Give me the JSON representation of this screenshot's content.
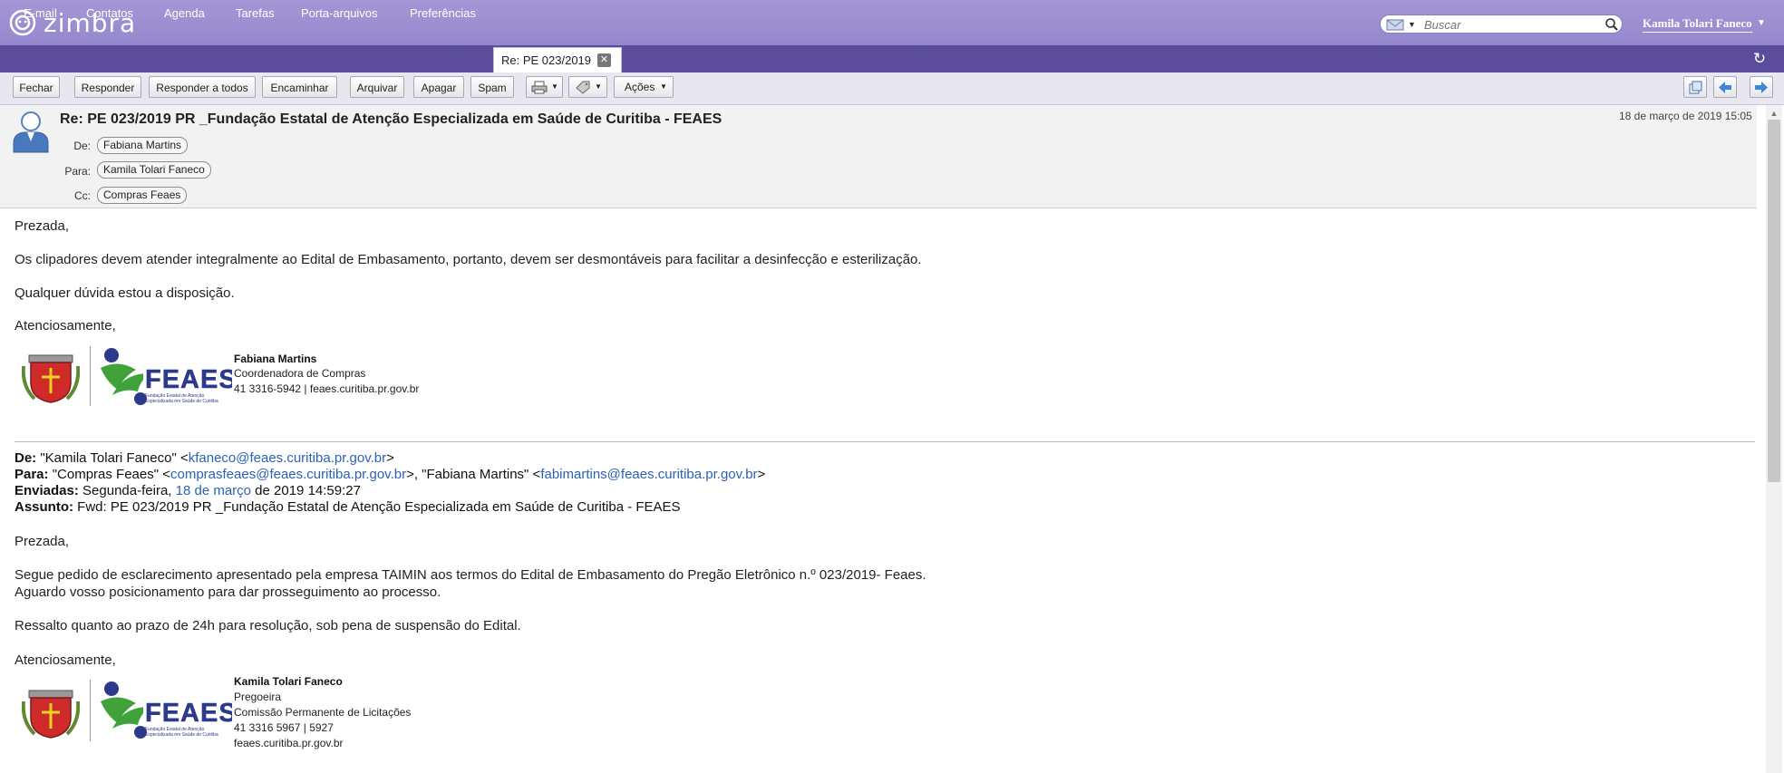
{
  "app": {
    "logo_text": "zimbra"
  },
  "search": {
    "placeholder": "Buscar"
  },
  "user": {
    "name": "Kamila Tolari Faneco"
  },
  "tabs": [
    {
      "label": "E-mail"
    },
    {
      "label": "Contatos"
    },
    {
      "label": "Agenda"
    },
    {
      "label": "Tarefas"
    },
    {
      "label": "Porta-arquivos"
    },
    {
      "label": "Preferências"
    }
  ],
  "active_tab": {
    "label": "Re: PE 023/2019"
  },
  "toolbar": {
    "close": "Fechar",
    "reply": "Responder",
    "reply_all": "Responder a todos",
    "forward": "Encaminhar",
    "archive": "Arquivar",
    "delete": "Apagar",
    "spam": "Spam",
    "actions": "Ações"
  },
  "message": {
    "subject": "Re: PE 023/2019 PR _Fundação Estatal de Atenção Especializada em Saúde de Curitiba - FEAES",
    "date": "18 de março de 2019 15:05",
    "from_label": "De:",
    "from": "Fabiana Martins",
    "to_label": "Para:",
    "to": "Kamila Tolari Faneco",
    "cc_label": "Cc:",
    "cc": "Compras Feaes"
  },
  "body": {
    "greeting": "Prezada,",
    "p1": "Os clipadores devem atender integralmente ao Edital de Embasamento, portanto, devem ser desmontáveis para facilitar a desinfecção e esterilização.",
    "p2": "Qualquer dúvida estou a disposição.",
    "closing": "Atenciosamente,",
    "sig": {
      "name": "Fabiana Martins",
      "role": "Coordenadora de Compras",
      "contact": "41 3316-5942 | feaes.curitiba.pr.gov.br"
    }
  },
  "feaes_logo": {
    "text": "FEAES",
    "sub1": "Fundação Estatal de Atenção",
    "sub2": "Especializada em Saúde de Curitiba"
  },
  "quoted": {
    "from_label": "De:",
    "from_name": "\"Kamila Tolari Faneco\" <",
    "from_email": "kfaneco@feaes.curitiba.pr.gov.br",
    "from_end": ">",
    "to_label": "Para:",
    "to_name1": "\"Compras Feaes\" <",
    "to_email1": "comprasfeaes@feaes.curitiba.pr.gov.br",
    "to_mid": ">, \"Fabiana Martins\" <",
    "to_email2": "fabimartins@feaes.curitiba.pr.gov.br",
    "to_end": ">",
    "sent_label": "Enviadas:",
    "sent_pre": "Segunda-feira, ",
    "sent_link": "18 de março",
    "sent_post": " de 2019 14:59:27",
    "subject_label": "Assunto:",
    "subject": "Fwd: PE 023/2019 PR _Fundação Estatal de Atenção Especializada em Saúde de Curitiba - FEAES",
    "greeting": "Prezada,",
    "p1": "Segue pedido de esclarecimento apresentado pela empresa TAIMIN aos termos do Edital de Embasamento do Pregão Eletrônico n.º 023/2019- Feaes.",
    "p2": "Aguardo vosso posicionamento para dar prosseguimento ao processo.",
    "p3": "Ressalto quanto ao prazo de 24h para resolução, sob pena de suspensão do Edital.",
    "closing": "Atenciosamente,",
    "sig": {
      "name": "Kamila Tolari Faneco",
      "role": "Pregoeira",
      "dept": "Comissão Permanente de Licitações",
      "phone": "41 3316 5967 | 5927",
      "site": "feaes.curitiba.pr.gov.br"
    }
  }
}
